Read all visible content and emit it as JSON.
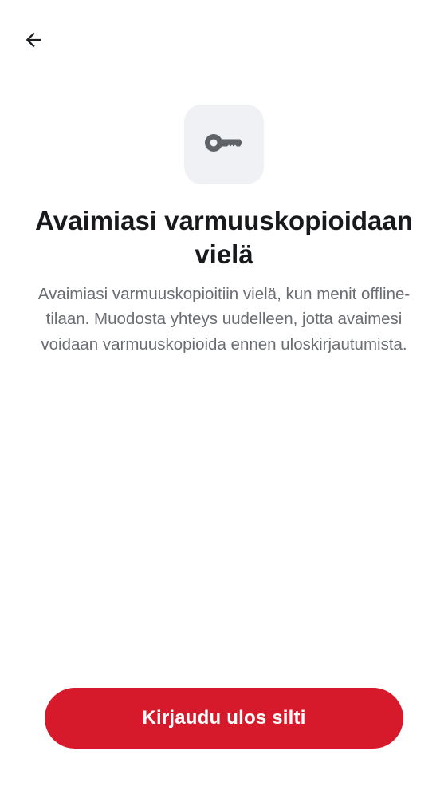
{
  "header": {
    "back_icon": "arrow-left-icon"
  },
  "content": {
    "icon": "key-icon",
    "title": "Avaimiasi varmuuskopioidaan vielä",
    "description": "Avaimiasi varmuuskopioitiin vielä, kun menit offline-tilaan. Muodosta yhteys uudelleen, jotta avaimesi voidaan varmuuskopioida ennen uloskirjautumista."
  },
  "actions": {
    "sign_out_label": "Kirjaudu ulos silti"
  },
  "colors": {
    "accent": "#d71a2b",
    "icon_tile": "#f0f1f5",
    "title": "#17191c",
    "description": "#6a6d74"
  }
}
